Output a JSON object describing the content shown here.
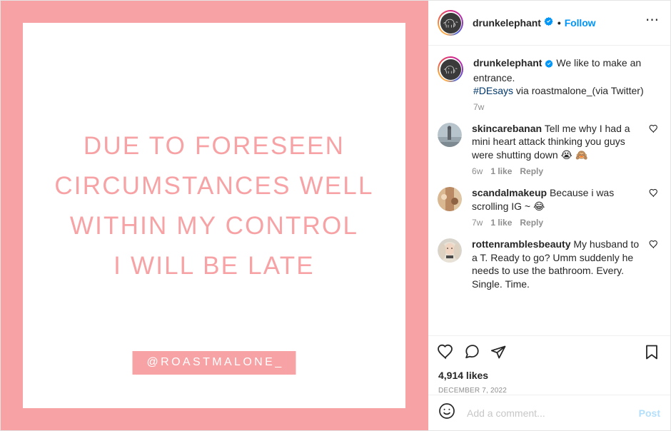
{
  "post_image": {
    "quote_text": "DUE TO FORESEEN\nCIRCUMSTANCES WELL\nWITHIN MY CONTROL\nI WILL BE LATE",
    "attribution_handle": "@ROASTMALONE_",
    "frame_color": "#F7A3A6",
    "text_color": "#F7A3A6",
    "card_color": "#FFFFFF"
  },
  "header": {
    "username": "drunkelephant",
    "verified_icon": "verified-badge-icon",
    "separator": "•",
    "follow_label": "Follow",
    "more_options_icon": "ellipsis-icon",
    "avatar_icon": "elephant-avatar",
    "link_color": "#0095F6"
  },
  "caption": {
    "username": "drunkelephant",
    "text": "We like to make an entrance.",
    "hashtag": "#DEsays",
    "rest": "via roastmalone_(via Twitter)",
    "timestamp": "7w"
  },
  "comments": [
    {
      "username": "skincarebanan",
      "text": "Tell me why I had a mini heart attack thinking you guys were shutting down",
      "emoji": "😭 🙈",
      "timestamp": "6w",
      "likes": "1 like",
      "reply_label": "Reply",
      "like_icon": "heart-outline-icon"
    },
    {
      "username": "scandalmakeup",
      "text": "Because i was scrolling IG ~",
      "emoji": "😂",
      "timestamp": "7w",
      "likes": "1 like",
      "reply_label": "Reply",
      "like_icon": "heart-outline-icon"
    },
    {
      "username": "rottenramblesbeauty",
      "text": "My husband to a T. Ready to go? Umm suddenly he needs to use the bathroom. Every. Single. Time.",
      "emoji": "",
      "timestamp": "",
      "likes": "",
      "reply_label": "",
      "like_icon": "heart-outline-icon"
    }
  ],
  "actions": {
    "like_icon": "heart-outline-icon",
    "comment_icon": "comment-bubble-icon",
    "share_icon": "paper-plane-icon",
    "save_icon": "bookmark-outline-icon"
  },
  "engagement": {
    "likes": "4,914 likes",
    "date": "DECEMBER 7, 2022"
  },
  "composer": {
    "emoji_icon": "smiley-face-icon",
    "placeholder": "Add a comment...",
    "post_label": "Post",
    "post_color": "#B2DFFC"
  }
}
